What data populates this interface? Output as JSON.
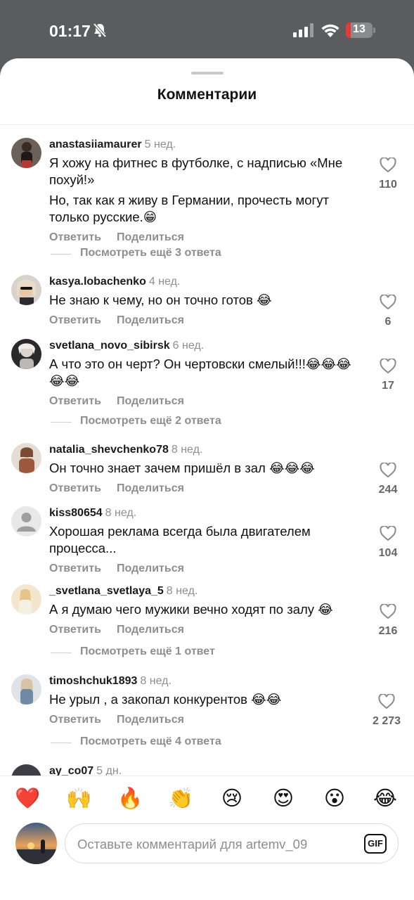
{
  "status_bar": {
    "time": "01:17",
    "battery": "13"
  },
  "sheet": {
    "title": "Комментарии"
  },
  "actions": {
    "reply": "Ответить",
    "share": "Поделиться"
  },
  "comments": [
    {
      "user": "anastasiiamaurer",
      "time": "5 нед.",
      "lines": [
        "Я хожу на фитнес в футболке, с надписью «Мне похуй!»",
        "Но, так как я живу в Германии, прочесть могут только русские.😁"
      ],
      "likes": "110",
      "replies": "Посмотреть ещё 3 ответа"
    },
    {
      "user": "kasya.lobachenko",
      "time": "4 нед.",
      "lines": [
        "Не знаю к чему, но он точно готов 😂"
      ],
      "likes": "6",
      "replies": ""
    },
    {
      "user": "svetlana_novo_sibirsk",
      "time": "6 нед.",
      "lines": [
        "А что это он черт?  Он чертовски смелый!!!😂😂😂😂😂"
      ],
      "likes": "17",
      "replies": "Посмотреть ещё 2 ответа"
    },
    {
      "user": "natalia_shevchenko78",
      "time": "8 нед.",
      "lines": [
        "Он точно знает зачем пришёл в зал 😂😂😂"
      ],
      "likes": "244",
      "replies": ""
    },
    {
      "user": "kiss80654",
      "time": "8 нед.",
      "lines": [
        "Хорошая реклама всегда была двигателем процесса..."
      ],
      "likes": "104",
      "replies": ""
    },
    {
      "user": "_svetlana_svetlaya_5",
      "time": "8 нед.",
      "lines": [
        "А я думаю чего мужики вечно ходят по залу 😂"
      ],
      "likes": "216",
      "replies": "Посмотреть ещё 1 ответ"
    },
    {
      "user": "timoshchuk1893",
      "time": "8 нед.",
      "lines": [
        "Не урыл , а закопал конкурентов 😂😂"
      ],
      "likes": "2 273",
      "replies": "Посмотреть ещё 4 ответа"
    },
    {
      "user": "ay_co07",
      "time": "5 дн.",
      "lines": [],
      "likes": "",
      "replies": ""
    }
  ],
  "emoji_bar": [
    "❤️",
    "🙌",
    "🔥",
    "👏",
    "😢",
    "😍",
    "😮",
    "😂"
  ],
  "composer": {
    "placeholder": "Оставьте комментарий для artemv_09",
    "gif_label": "GIF"
  },
  "colors": {
    "accent_text": "#111111",
    "muted_text": "#8e8e8e",
    "battery_low": "#e53935"
  }
}
